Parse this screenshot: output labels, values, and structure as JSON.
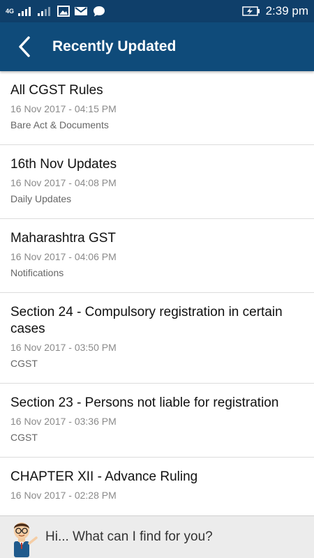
{
  "status_bar": {
    "network_label": "4G",
    "time": "2:39 pm",
    "icons": [
      "signal-icon",
      "signal-icon",
      "image-icon",
      "gmail-icon",
      "chat-icon",
      "battery-icon"
    ]
  },
  "app_bar": {
    "title": "Recently Updated",
    "back_icon": "chevron-left-icon",
    "color": "#0f4b7a"
  },
  "items": [
    {
      "title": "All CGST Rules",
      "date": "16 Nov 2017 - 04:15 PM",
      "category": "Bare Act & Documents"
    },
    {
      "title": "16th Nov Updates",
      "date": "16 Nov 2017 - 04:08 PM",
      "category": "Daily Updates"
    },
    {
      "title": "Maharashtra GST",
      "date": "16 Nov 2017 - 04:06 PM",
      "category": "Notifications"
    },
    {
      "title": "Section 24 - Compulsory registration in certain cases",
      "date": "16 Nov 2017 - 03:50 PM",
      "category": "CGST"
    },
    {
      "title": "Section 23 - Persons not liable for registration",
      "date": "16 Nov 2017 - 03:36 PM",
      "category": "CGST"
    },
    {
      "title": "CHAPTER XII - Advance Ruling",
      "date": "16 Nov 2017 - 02:28 PM",
      "category": ""
    }
  ],
  "assistant": {
    "prompt": "Hi... What can I find for you?",
    "avatar_icon": "assistant-avatar-icon"
  }
}
